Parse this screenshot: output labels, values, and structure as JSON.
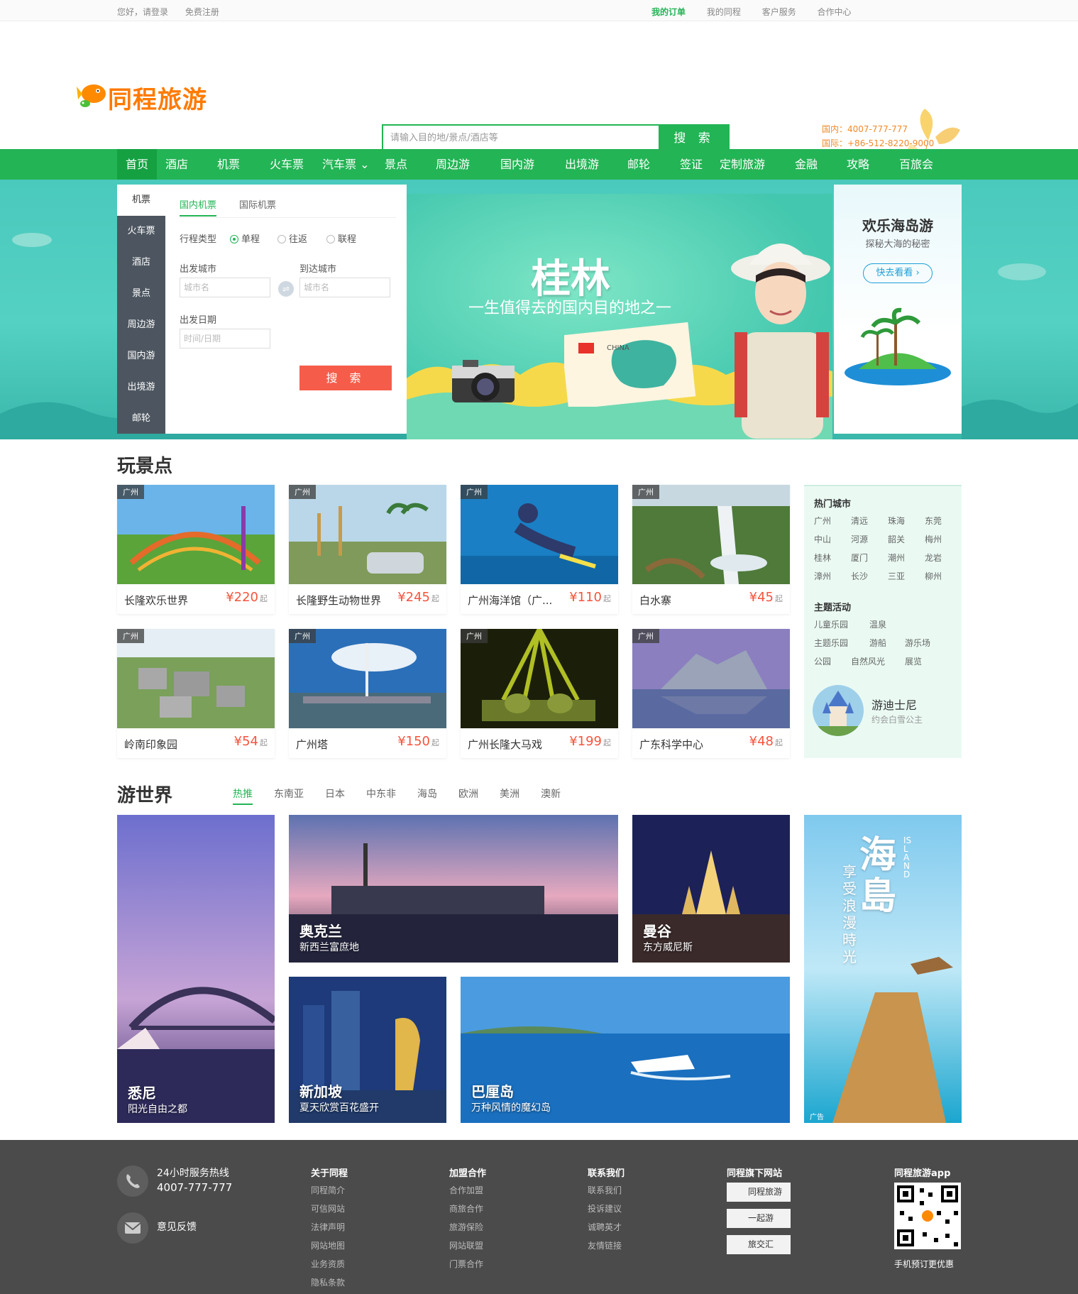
{
  "topbar": {
    "greeting": "您好，请登录",
    "register": "免费注册",
    "links": [
      "我的订单",
      "我的同程",
      "客户服务",
      "合作中心"
    ]
  },
  "header": {
    "logo_text": "同程旅游",
    "search_placeholder": "请输入目的地/景点/酒店等",
    "search_button": "搜 索",
    "hotline_domestic": "国内：4007-777-777",
    "hotline_intl": "国际：+86-512-8220-9000"
  },
  "nav": [
    "首页",
    "酒店",
    "机票",
    "火车票",
    "汽车票 ⌄",
    "景点",
    "周边游",
    "国内游",
    "出境游",
    "邮轮",
    "签证",
    "定制旅游",
    "金融",
    "攻略",
    "百旅会"
  ],
  "booking": {
    "side_items": [
      "机票",
      "火车票",
      "酒店",
      "景点",
      "周边游",
      "国内游",
      "出境游",
      "邮轮"
    ],
    "tabs": [
      "国内机票",
      "国际机票"
    ],
    "trip_type_label": "行程类型",
    "trip_types": [
      "单程",
      "往返",
      "联程"
    ],
    "from_label": "出发城市",
    "to_label": "到达城市",
    "from_placeholder": "城市名",
    "to_placeholder": "城市名",
    "date_label": "出发日期",
    "date_placeholder": "时间/日期",
    "submit": "搜 索"
  },
  "hero": {
    "title": "桂林",
    "subtitle": "一生值得去的国内目的地之一"
  },
  "promo": {
    "title": "欢乐海岛游",
    "subtitle": "探秘大海的秘密",
    "button": "快去看看 ›"
  },
  "attractions": {
    "title": "玩景点",
    "cards": [
      {
        "tag": "广州",
        "name": "长隆欢乐世界",
        "price": "¥220",
        "unit": "起"
      },
      {
        "tag": "广州",
        "name": "长隆野生动物世界",
        "price": "¥245",
        "unit": "起"
      },
      {
        "tag": "广州",
        "name": "广州海洋馆（广...",
        "price": "¥110",
        "unit": "起"
      },
      {
        "tag": "广州",
        "name": "白水寨",
        "price": "¥45",
        "unit": "起"
      },
      {
        "tag": "广州",
        "name": "岭南印象园",
        "price": "¥54",
        "unit": "起"
      },
      {
        "tag": "广州",
        "name": "广州塔",
        "price": "¥150",
        "unit": "起"
      },
      {
        "tag": "广州",
        "name": "广州长隆大马戏",
        "price": "¥199",
        "unit": "起"
      },
      {
        "tag": "广州",
        "name": "广东科学中心",
        "price": "¥48",
        "unit": "起"
      }
    ],
    "side": {
      "hot_cities_title": "热门城市",
      "hot_cities": [
        "广州",
        "清远",
        "珠海",
        "东莞",
        "中山",
        "河源",
        "韶关",
        "梅州",
        "桂林",
        "厦门",
        "潮州",
        "龙岩",
        "漳州",
        "长沙",
        "三亚",
        "柳州"
      ],
      "themes_title": "主题活动",
      "themes": [
        "儿童乐园",
        "温泉",
        "主题乐园",
        "游船",
        "游乐场",
        "公园",
        "自然风光",
        "展览"
      ],
      "feature_title": "游迪士尼",
      "feature_sub": "约会白雪公主"
    }
  },
  "world": {
    "title": "游世界",
    "tabs": [
      "热推",
      "东南亚",
      "日本",
      "中东非",
      "海岛",
      "欧洲",
      "美洲",
      "澳新"
    ],
    "destinations": [
      {
        "name": "悉尼",
        "desc": "阳光自由之都"
      },
      {
        "name": "奥克兰",
        "desc": "新西兰富庶地"
      },
      {
        "name": "曼谷",
        "desc": "东方威尼斯"
      },
      {
        "name": "新加坡",
        "desc": "夏天欣赏百花盛开"
      },
      {
        "name": "巴厘岛",
        "desc": "万种风情的魔幻岛"
      }
    ],
    "ad": {
      "big": "海島",
      "small": "享受浪漫時光",
      "en": "ISLAND",
      "tag": "广告"
    }
  },
  "footer": {
    "hotline_label": "24小时服务热线",
    "hotline_number": "4007-777-777",
    "feedback": "意见反馈",
    "columns": [
      {
        "title": "关于同程",
        "links": [
          "同程简介",
          "可信网站",
          "法律声明",
          "网站地图",
          "业务资质",
          "隐私条款"
        ]
      },
      {
        "title": "加盟合作",
        "links": [
          "合作加盟",
          "商旅合作",
          "旅游保险",
          "网站联盟",
          "门票合作"
        ]
      },
      {
        "title": "联系我们",
        "links": [
          "联系我们",
          "投诉建议",
          "诚聘英才",
          "友情链接"
        ]
      }
    ],
    "sites_title": "同程旗下网站",
    "sites": [
      "同程旅游",
      "一起游",
      "旅交汇"
    ],
    "app_title": "同程旅游app",
    "app_caption": "手机预订更优惠"
  }
}
